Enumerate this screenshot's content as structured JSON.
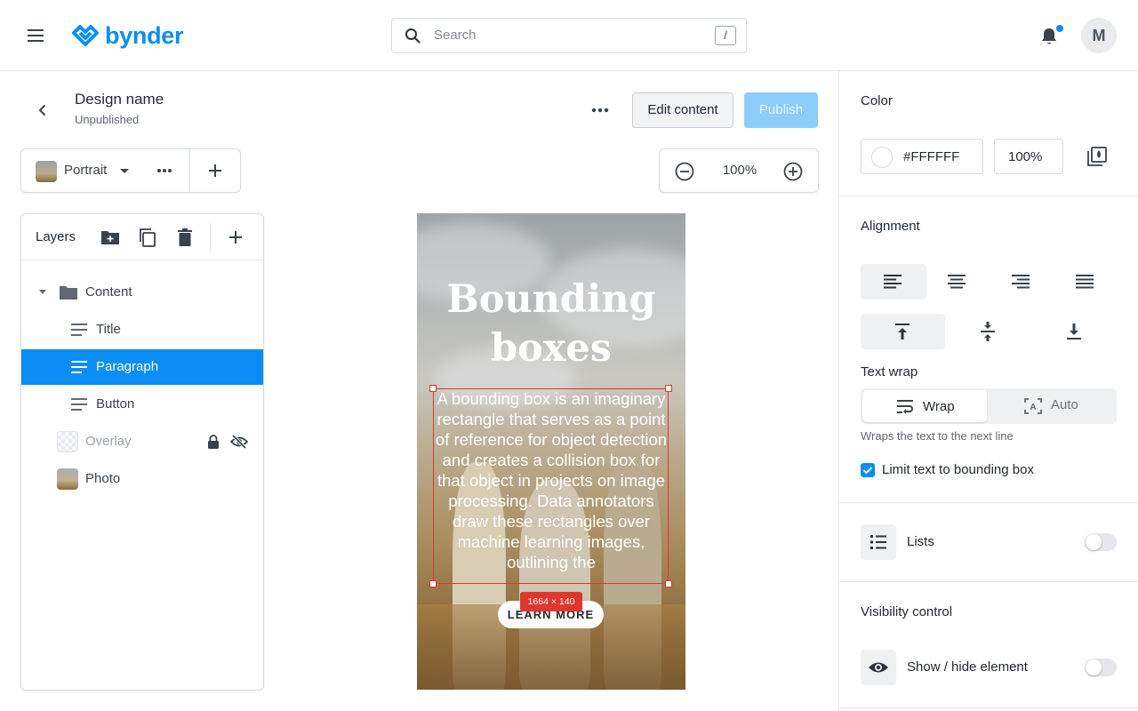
{
  "brand": {
    "name": "bynder"
  },
  "search": {
    "placeholder": "Search",
    "shortcut": "/"
  },
  "user": {
    "initial": "M"
  },
  "design": {
    "name": "Design name",
    "status": "Unpublished"
  },
  "actions": {
    "edit_label": "Edit content",
    "publish_label": "Publish"
  },
  "format": {
    "label": "Portrait"
  },
  "zoom": {
    "value": "100%"
  },
  "layers": {
    "title": "Layers",
    "items": [
      {
        "label": "Content"
      },
      {
        "label": "Title"
      },
      {
        "label": "Paragraph"
      },
      {
        "label": "Button"
      },
      {
        "label": "Overlay"
      },
      {
        "label": "Photo"
      }
    ]
  },
  "canvas": {
    "title": "Bounding boxes",
    "paragraph": "A bounding box is an imaginary rectangle that serves as a point of reference for object detection and creates a collision box for that object in projects on image processing. Data annotators draw these rectangles over machine learning images, outlining the",
    "button": "LEARN MORE",
    "selection_size": "1664 × 140"
  },
  "panel": {
    "color": {
      "title": "Color",
      "hex": "#FFFFFF",
      "opacity": "100%"
    },
    "alignment": {
      "title": "Alignment"
    },
    "text_wrap": {
      "title": "Text wrap",
      "wrap_label": "Wrap",
      "auto_label": "Auto",
      "hint": "Wraps the text to the next line",
      "limit_label": "Limit text to bounding box"
    },
    "lists": {
      "label": "Lists"
    },
    "visibility": {
      "title": "Visibility control",
      "label": "Show / hide element"
    }
  },
  "colors": {
    "accent": "#0A8EF5",
    "selection": "#E0372D"
  }
}
